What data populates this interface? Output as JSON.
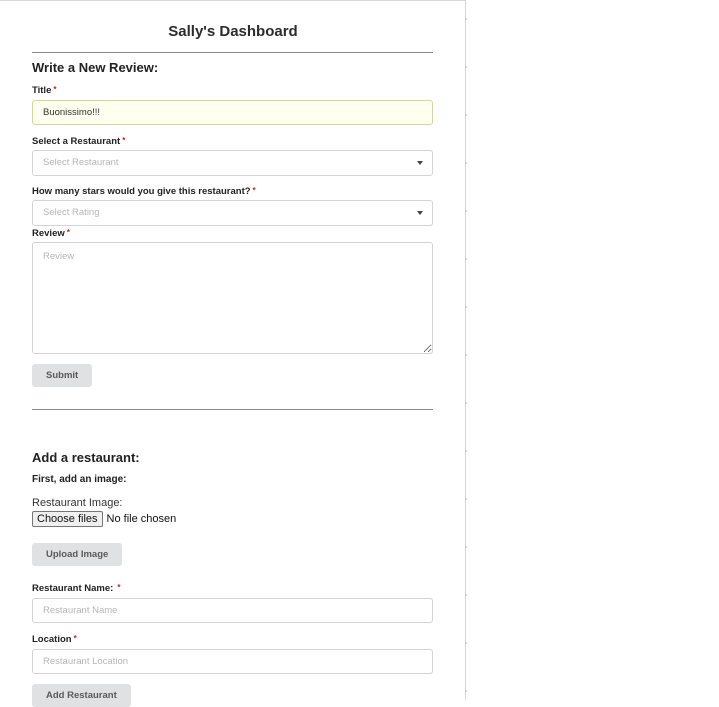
{
  "dashboard": {
    "title": "Sally's Dashboard"
  },
  "review_form": {
    "heading": "Write a New Review:",
    "title_label": "Title",
    "title_value": "Buonissimo!!!",
    "restaurant_label": "Select a Restaurant",
    "restaurant_placeholder": "Select Restaurant",
    "rating_label": "How many stars would you give this restaurant?",
    "rating_placeholder": "Select Rating",
    "review_label": "Review",
    "review_placeholder": "Review",
    "submit_label": "Submit",
    "required_mark": "*"
  },
  "restaurant_form": {
    "heading": "Add a restaurant:",
    "image_step": "First, add an image:",
    "image_label": "Restaurant Image:",
    "file_button": "Choose files",
    "file_status": "No file chosen",
    "upload_label": "Upload Image",
    "name_label": "Restaurant Name:",
    "name_placeholder": "Restaurant Name",
    "location_label": "Location",
    "location_placeholder": "Restaurant Location",
    "add_label": "Add Restaurant",
    "required_mark": "*"
  }
}
